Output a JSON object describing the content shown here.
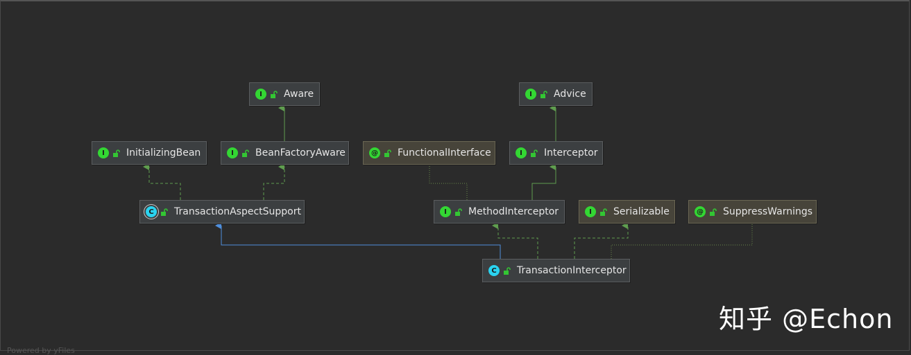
{
  "diagram": {
    "nodes": {
      "aware": {
        "label": "Aware",
        "kind": "interface",
        "badge": "I"
      },
      "advice": {
        "label": "Advice",
        "kind": "interface",
        "badge": "I"
      },
      "initializing_bean": {
        "label": "InitializingBean",
        "kind": "interface",
        "badge": "I"
      },
      "bean_factory_aware": {
        "label": "BeanFactoryAware",
        "kind": "interface",
        "badge": "I"
      },
      "functional_interface": {
        "label": "FunctionalInterface",
        "kind": "annotation",
        "badge": "@"
      },
      "interceptor": {
        "label": "Interceptor",
        "kind": "interface",
        "badge": "I"
      },
      "transaction_aspect_support": {
        "label": "TransactionAspectSupport",
        "kind": "abstract",
        "badge": "C"
      },
      "method_interceptor": {
        "label": "MethodInterceptor",
        "kind": "interface",
        "badge": "I"
      },
      "serializable": {
        "label": "Serializable",
        "kind": "interface",
        "badge": "I"
      },
      "suppress_warnings": {
        "label": "SuppressWarnings",
        "kind": "annotation",
        "badge": "@"
      },
      "transaction_interceptor": {
        "label": "TransactionInterceptor",
        "kind": "class",
        "badge": "C"
      }
    },
    "colors": {
      "implements": "#5f9d4f",
      "extends": "#4f8fdc",
      "annotated": "#6a8a4a",
      "interface_badge": "#33d733",
      "class_badge": "#2ad3f0"
    }
  },
  "watermark": "知乎 @Echon",
  "footer": "Powered by yFiles"
}
